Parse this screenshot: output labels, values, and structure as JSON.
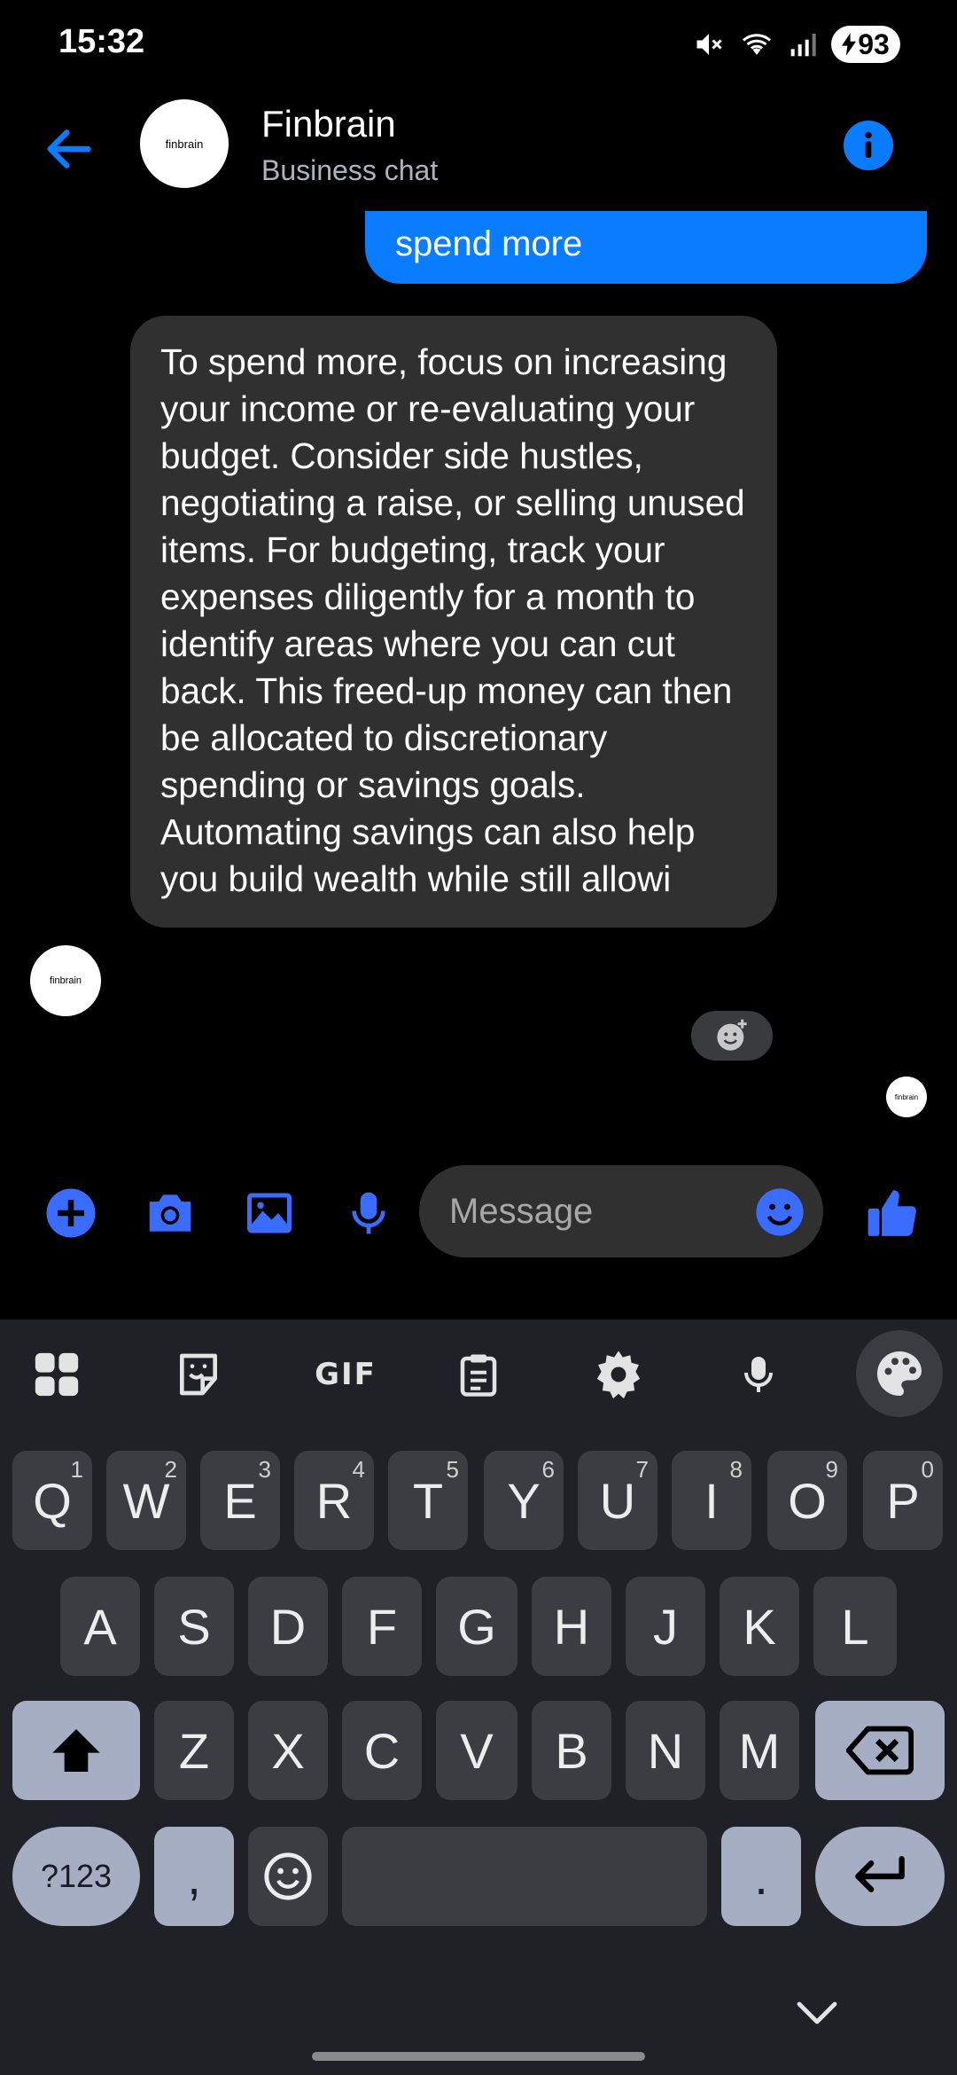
{
  "status": {
    "time": "15:32",
    "battery": "93",
    "icons": [
      "mute-icon",
      "wifi-icon",
      "signal-icon",
      "battery-charging-icon"
    ]
  },
  "header": {
    "title": "Finbrain",
    "subtitle": "Business chat",
    "avatar_text": "finbrain"
  },
  "messages": [
    {
      "direction": "outgoing",
      "text": "spend more"
    },
    {
      "direction": "incoming",
      "text": "To spend more, focus on increasing your income or re-evaluating your budget. Consider side hustles, negotiating a raise, or selling unused items. For budgeting, track your expenses diligently for a month to identify areas where you can cut back. This freed-up money can then be allocated to discretionary spending or savings goals. Automating savings can also help you build wealth while still allowi"
    }
  ],
  "receipt_avatar_text": "finbrain",
  "composer": {
    "placeholder": "Message"
  },
  "keyboard": {
    "toolbar": {
      "gif": "GIF"
    },
    "row1": [
      {
        "k": "Q",
        "h": "1"
      },
      {
        "k": "W",
        "h": "2"
      },
      {
        "k": "E",
        "h": "3"
      },
      {
        "k": "R",
        "h": "4"
      },
      {
        "k": "T",
        "h": "5"
      },
      {
        "k": "Y",
        "h": "6"
      },
      {
        "k": "U",
        "h": "7"
      },
      {
        "k": "I",
        "h": "8"
      },
      {
        "k": "O",
        "h": "9"
      },
      {
        "k": "P",
        "h": "0"
      }
    ],
    "row2": [
      "A",
      "S",
      "D",
      "F",
      "G",
      "H",
      "J",
      "K",
      "L"
    ],
    "row3": [
      "Z",
      "X",
      "C",
      "V",
      "B",
      "N",
      "M"
    ],
    "symbols": "?123",
    "comma": ",",
    "period": "."
  },
  "colors": {
    "accent": "#0a7cff",
    "bubble_incoming": "#303030",
    "keyboard_bg": "#1f2126"
  }
}
